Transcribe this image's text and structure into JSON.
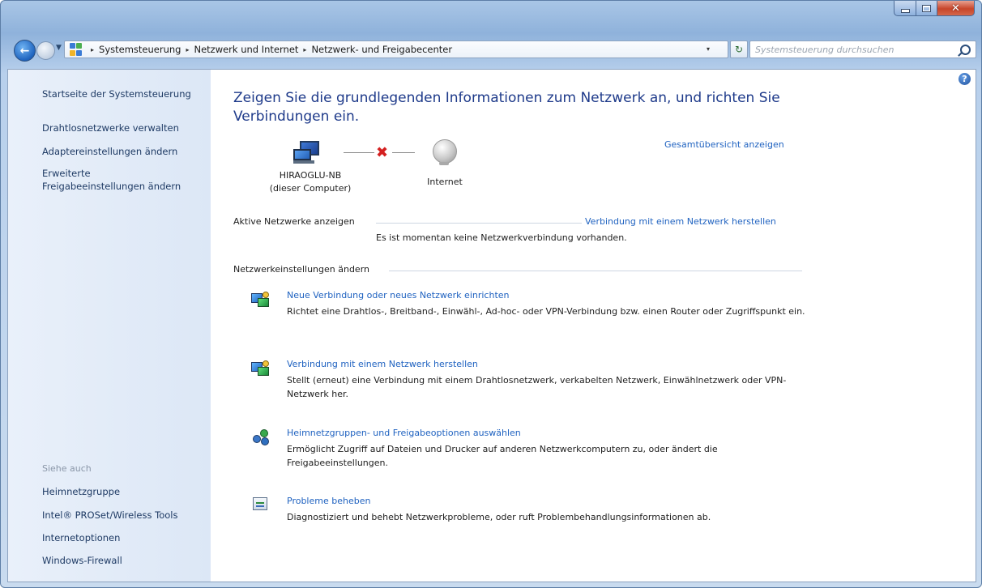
{
  "window": {
    "caption": {
      "minimize": "–",
      "maximize": "□",
      "close": "✕"
    }
  },
  "address_bar": {
    "breadcrumbs": [
      "Systemsteuerung",
      "Netzwerk und Internet",
      "Netzwerk- und Freigabecenter"
    ],
    "separator": "▸",
    "dropdown": "▾",
    "refresh": "↻"
  },
  "search": {
    "placeholder": "Systemsteuerung durchsuchen"
  },
  "sidebar": {
    "home": "Startseite der Systemsteuerung",
    "links": [
      "Drahtlosnetzwerke verwalten",
      "Adaptereinstellungen ändern",
      "Erweiterte Freigabeeinstellungen ändern"
    ],
    "see_also_label": "Siehe auch",
    "see_also": [
      "Heimnetzgruppe",
      "Intel® PROSet/Wireless Tools",
      "Internetoptionen",
      "Windows-Firewall"
    ]
  },
  "help": "?",
  "main": {
    "title": "Zeigen Sie die grundlegenden Informationen zum Netzwerk an, und richten Sie Verbindungen ein.",
    "overview_link": "Gesamtübersicht anzeigen",
    "computer": {
      "name": "HIRAOGLU-NB",
      "subtitle": "(dieser Computer)"
    },
    "internet_label": "Internet",
    "disconnected_mark": "✖",
    "active_networks": {
      "heading": "Aktive Netzwerke anzeigen",
      "link": "Verbindung mit einem Netzwerk herstellen",
      "status": "Es ist momentan keine Netzwerkverbindung vorhanden."
    },
    "settings_heading": "Netzwerkeinstellungen ändern",
    "tasks": [
      {
        "icon": "network-setup-icon",
        "link": "Neue Verbindung oder neues Netzwerk einrichten",
        "desc": "Richtet eine Drahtlos-, Breitband-, Einwähl-, Ad-hoc- oder VPN-Verbindung bzw. einen Router oder Zugriffspunkt ein."
      },
      {
        "icon": "network-connect-icon",
        "link": "Verbindung mit einem Netzwerk herstellen",
        "desc": "Stellt (erneut) eine Verbindung mit einem Drahtlosnetzwerk, verkabelten Netzwerk, Einwählnetzwerk oder VPN-Netzwerk her."
      },
      {
        "icon": "homegroup-icon",
        "link": "Heimnetzgruppen- und Freigabeoptionen auswählen",
        "desc": "Ermöglicht Zugriff auf Dateien und Drucker auf anderen Netzwerkcomputern zu, oder ändert die Freigabeeinstellungen."
      },
      {
        "icon": "troubleshoot-icon",
        "link": "Probleme beheben",
        "desc": "Diagnostiziert und behebt Netzwerkprobleme, oder ruft Problembehandlungsinformationen ab."
      }
    ]
  },
  "colors": {
    "link": "#1f62c0",
    "title": "#1e3a8a",
    "sidebar_bg": "#dce7f6",
    "error_red": "#d42020"
  }
}
